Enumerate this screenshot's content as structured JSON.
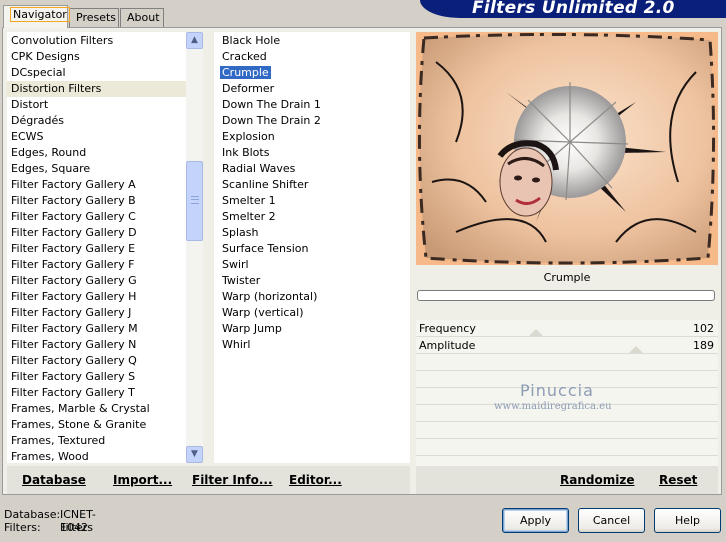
{
  "tabs": [
    {
      "label": "Navigator"
    },
    {
      "label": "Presets"
    },
    {
      "label": "About"
    }
  ],
  "title": "Filters Unlimited 2.0",
  "categories": {
    "selected": "Distortion Filters",
    "items": [
      "Convolution Filters",
      "CPK Designs",
      "DCspecial",
      "Distortion Filters",
      "Distort",
      "Dégradés",
      "ECWS",
      "Edges, Round",
      "Edges, Square",
      "Filter Factory Gallery A",
      "Filter Factory Gallery B",
      "Filter Factory Gallery C",
      "Filter Factory Gallery D",
      "Filter Factory Gallery E",
      "Filter Factory Gallery F",
      "Filter Factory Gallery G",
      "Filter Factory Gallery H",
      "Filter Factory Gallery J",
      "Filter Factory Gallery M",
      "Filter Factory Gallery N",
      "Filter Factory Gallery Q",
      "Filter Factory Gallery S",
      "Filter Factory Gallery T",
      "Frames, Marble & Crystal",
      "Frames, Stone & Granite",
      "Frames, Textured",
      "Frames, Wood"
    ]
  },
  "filters": {
    "selected": "Crumple",
    "items": [
      "Black Hole",
      "Cracked",
      "Crumple",
      "Deformer",
      "Down The Drain 1",
      "Down The Drain 2",
      "Explosion",
      "Ink Blots",
      "Radial Waves",
      "Scanline Shifter",
      "Smelter 1",
      "Smelter 2",
      "Splash",
      "Surface Tension",
      "Swirl",
      "Twister",
      "Warp (horizontal)",
      "Warp (vertical)",
      "Warp Jump",
      "Whirl"
    ]
  },
  "links": {
    "database": "Database",
    "import": "Import...",
    "filter_info": "Filter Info...",
    "editor": "Editor...",
    "randomize": "Randomize",
    "reset": "Reset"
  },
  "preview": {
    "caption": "Crumple",
    "progress": 0
  },
  "params": [
    {
      "label": "Frequency",
      "value": "102"
    },
    {
      "label": "Amplitude",
      "value": "189"
    }
  ],
  "watermark": {
    "name": "Pinuccia",
    "url": "www.maidiregrafica.eu"
  },
  "status": {
    "database_label": "Database:",
    "database_value": "ICNET-Filters",
    "filters_label": "Filters:",
    "filters_value": "1042"
  },
  "buttons": {
    "apply": "Apply",
    "cancel": "Cancel",
    "help": "Help"
  },
  "colors": {
    "selection": "#316ac5",
    "banner": "#0a1f7a",
    "preview_bg": "#f5b98a"
  }
}
